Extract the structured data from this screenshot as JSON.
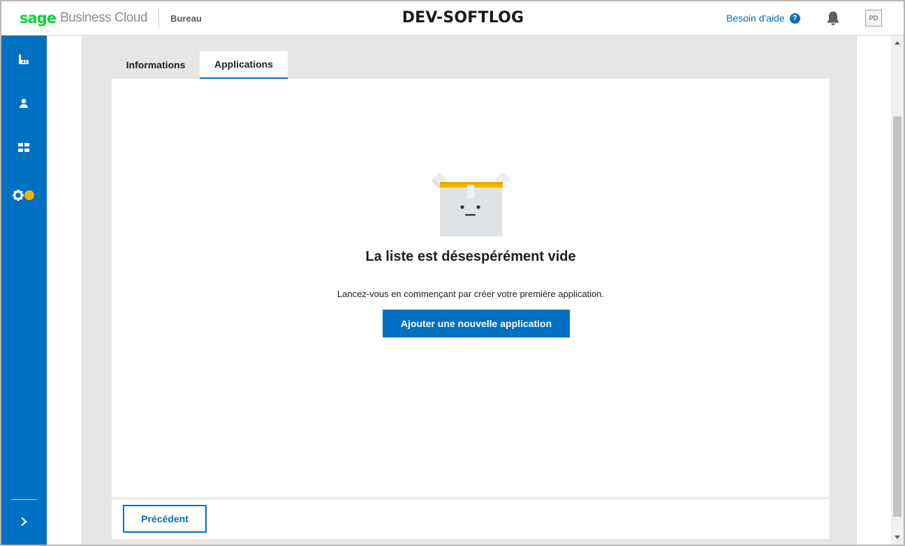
{
  "header": {
    "brand_primary": "sage",
    "brand_secondary": "Business Cloud",
    "module": "Bureau",
    "title": "DEV-SOFTLOG",
    "help_label": "Besoin d'aide",
    "help_icon": "?",
    "avatar_initials": "PD"
  },
  "sidebar": {
    "items": [
      {
        "icon": "factory-icon"
      },
      {
        "icon": "user-icon"
      },
      {
        "icon": "apps-grid-icon"
      },
      {
        "icon": "gear-icon",
        "badge_color": "#f5b400"
      }
    ],
    "expand_icon": "chevron-right-icon"
  },
  "tabs": [
    {
      "label": "Informations",
      "active": false
    },
    {
      "label": "Applications",
      "active": true
    }
  ],
  "empty_state": {
    "title": "La liste est désespérément vide",
    "text": "Lancez-vous en commençant par créer votre première application.",
    "button_label": "Ajouter une nouvelle application"
  },
  "footer": {
    "back_label": "Précédent"
  },
  "colors": {
    "accent": "#0070c2",
    "brand_green": "#00d639"
  }
}
